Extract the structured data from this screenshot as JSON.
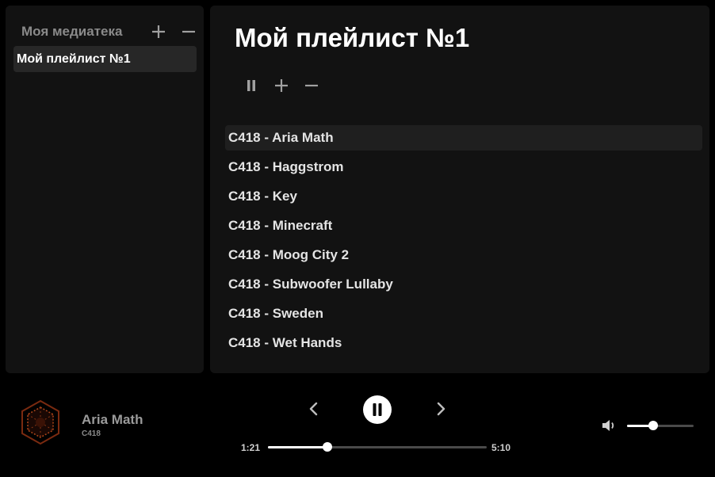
{
  "sidebar": {
    "title": "Моя медиатека",
    "add_icon": "plus-icon",
    "remove_icon": "minus-icon",
    "items": [
      {
        "label": "Мой плейлист №1",
        "selected": true
      }
    ]
  },
  "main": {
    "title": "Мой плейлист №1",
    "toolbar_icons": [
      "pause-icon",
      "plus-icon",
      "minus-icon"
    ],
    "tracks": [
      {
        "label": "C418 - Aria Math",
        "active": true
      },
      {
        "label": "C418 - Haggstrom"
      },
      {
        "label": "C418 - Key"
      },
      {
        "label": "C418 - Minecraft"
      },
      {
        "label": "C418 - Moog City 2"
      },
      {
        "label": "C418 - Subwoofer Lullaby"
      },
      {
        "label": "C418 - Sweden"
      },
      {
        "label": "C418 - Wet Hands"
      }
    ]
  },
  "player": {
    "title": "Aria Math",
    "artist": "C418",
    "current_time": "1:21",
    "total_time": "5:10",
    "progress": 0.27,
    "volume": 0.39,
    "icons": [
      "prev-icon",
      "pause-icon",
      "next-icon",
      "volume-icon"
    ]
  },
  "colors": {
    "background": "#000000",
    "panel": "#121212",
    "selected": "#272727",
    "hover_row": "#1f1f1f",
    "accent": "#ffffff",
    "muted": "#8a8a8a",
    "track_inactive": "#4a4a4a"
  }
}
